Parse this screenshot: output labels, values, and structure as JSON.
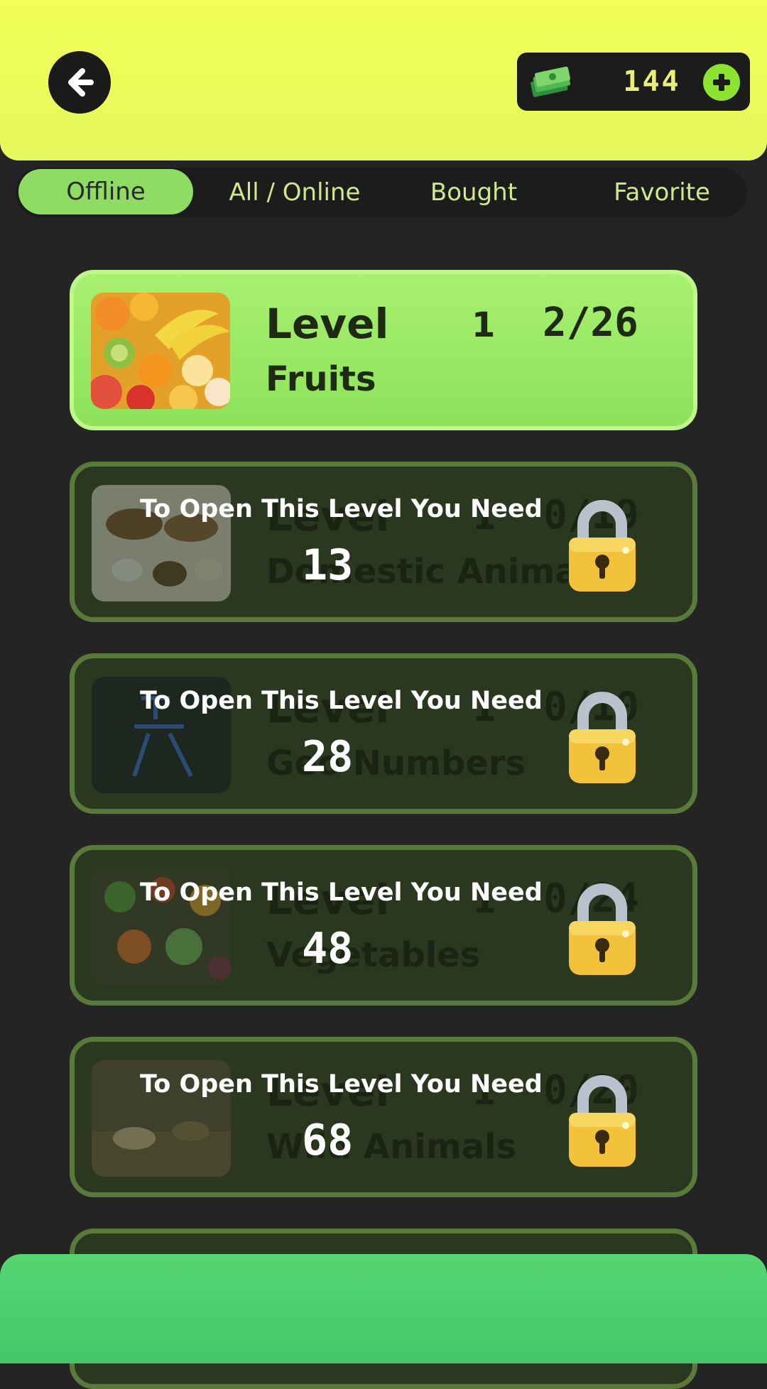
{
  "header": {
    "currency": "144"
  },
  "tabs": [
    {
      "label": "Offline",
      "active": true
    },
    {
      "label": "All / Online",
      "active": false
    },
    {
      "label": "Bought",
      "active": false
    },
    {
      "label": "Favorite",
      "active": false
    }
  ],
  "levels": [
    {
      "word": "Level",
      "number": "1",
      "progress": "2/26",
      "name": "Fruits",
      "locked": false,
      "thumb": "fruits"
    },
    {
      "word": "Level",
      "number": "1",
      "progress": "0/19",
      "name": "Domestic Animals",
      "locked": true,
      "need_label": "To Open This Level You Need",
      "need_count": "13",
      "thumb": "domestic-animals"
    },
    {
      "word": "Level",
      "number": "1",
      "progress": "0/10",
      "name": "Geo Numbers",
      "locked": true,
      "need_label": "To Open This Level You Need",
      "need_count": "28",
      "thumb": "numbers"
    },
    {
      "word": "Level",
      "number": "1",
      "progress": "0/24",
      "name": "Vegetables",
      "locked": true,
      "need_label": "To Open This Level You Need",
      "need_count": "48",
      "thumb": "vegetables"
    },
    {
      "word": "Level",
      "number": "1",
      "progress": "0/20",
      "name": "Wild Animals",
      "locked": true,
      "need_label": "To Open This Level You Need",
      "need_count": "68",
      "thumb": "wild-animals"
    }
  ],
  "colors": {
    "header": "#f0fd55",
    "active_tab": "#8fdc64",
    "unlocked_card": "#9aeb66",
    "locked_card": "#2a3820",
    "footer": "#4fd06f"
  }
}
